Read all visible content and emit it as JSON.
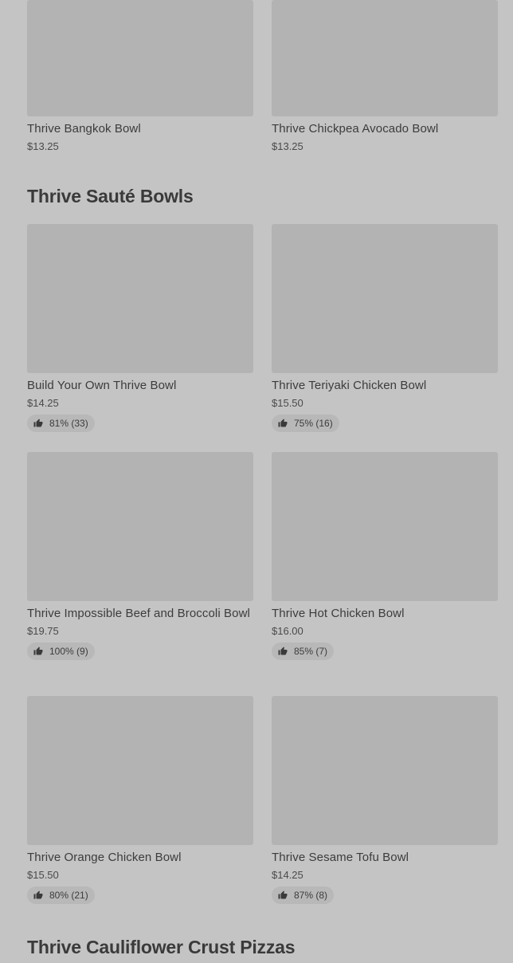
{
  "top_items": [
    {
      "name": "Thrive Bangkok Bowl",
      "price": "$13.25"
    },
    {
      "name": "Thrive Chickpea Avocado Bowl",
      "price": "$13.25"
    }
  ],
  "saute_section": {
    "title": "Thrive Sauté Bowls",
    "items": [
      {
        "name": "Build Your Own Thrive Bowl",
        "price": "$14.25",
        "rating": "81% (33)"
      },
      {
        "name": "Thrive Teriyaki Chicken Bowl",
        "price": "$15.50",
        "rating": "75% (16)"
      },
      {
        "name": "Thrive Impossible Beef and Broccoli Bowl",
        "price": "$19.75",
        "rating": "100% (9)"
      },
      {
        "name": "Thrive Hot Chicken Bowl",
        "price": "$16.00",
        "rating": "85% (7)"
      },
      {
        "name": "Thrive Orange Chicken Bowl",
        "price": "$15.50",
        "rating": "80% (21)"
      },
      {
        "name": "Thrive Sesame Tofu Bowl",
        "price": "$14.25",
        "rating": "87% (8)"
      }
    ]
  },
  "pizza_section": {
    "title": "Thrive Cauliflower Crust Pizzas"
  },
  "icons": {
    "rating": "thumbs-up-icon"
  }
}
